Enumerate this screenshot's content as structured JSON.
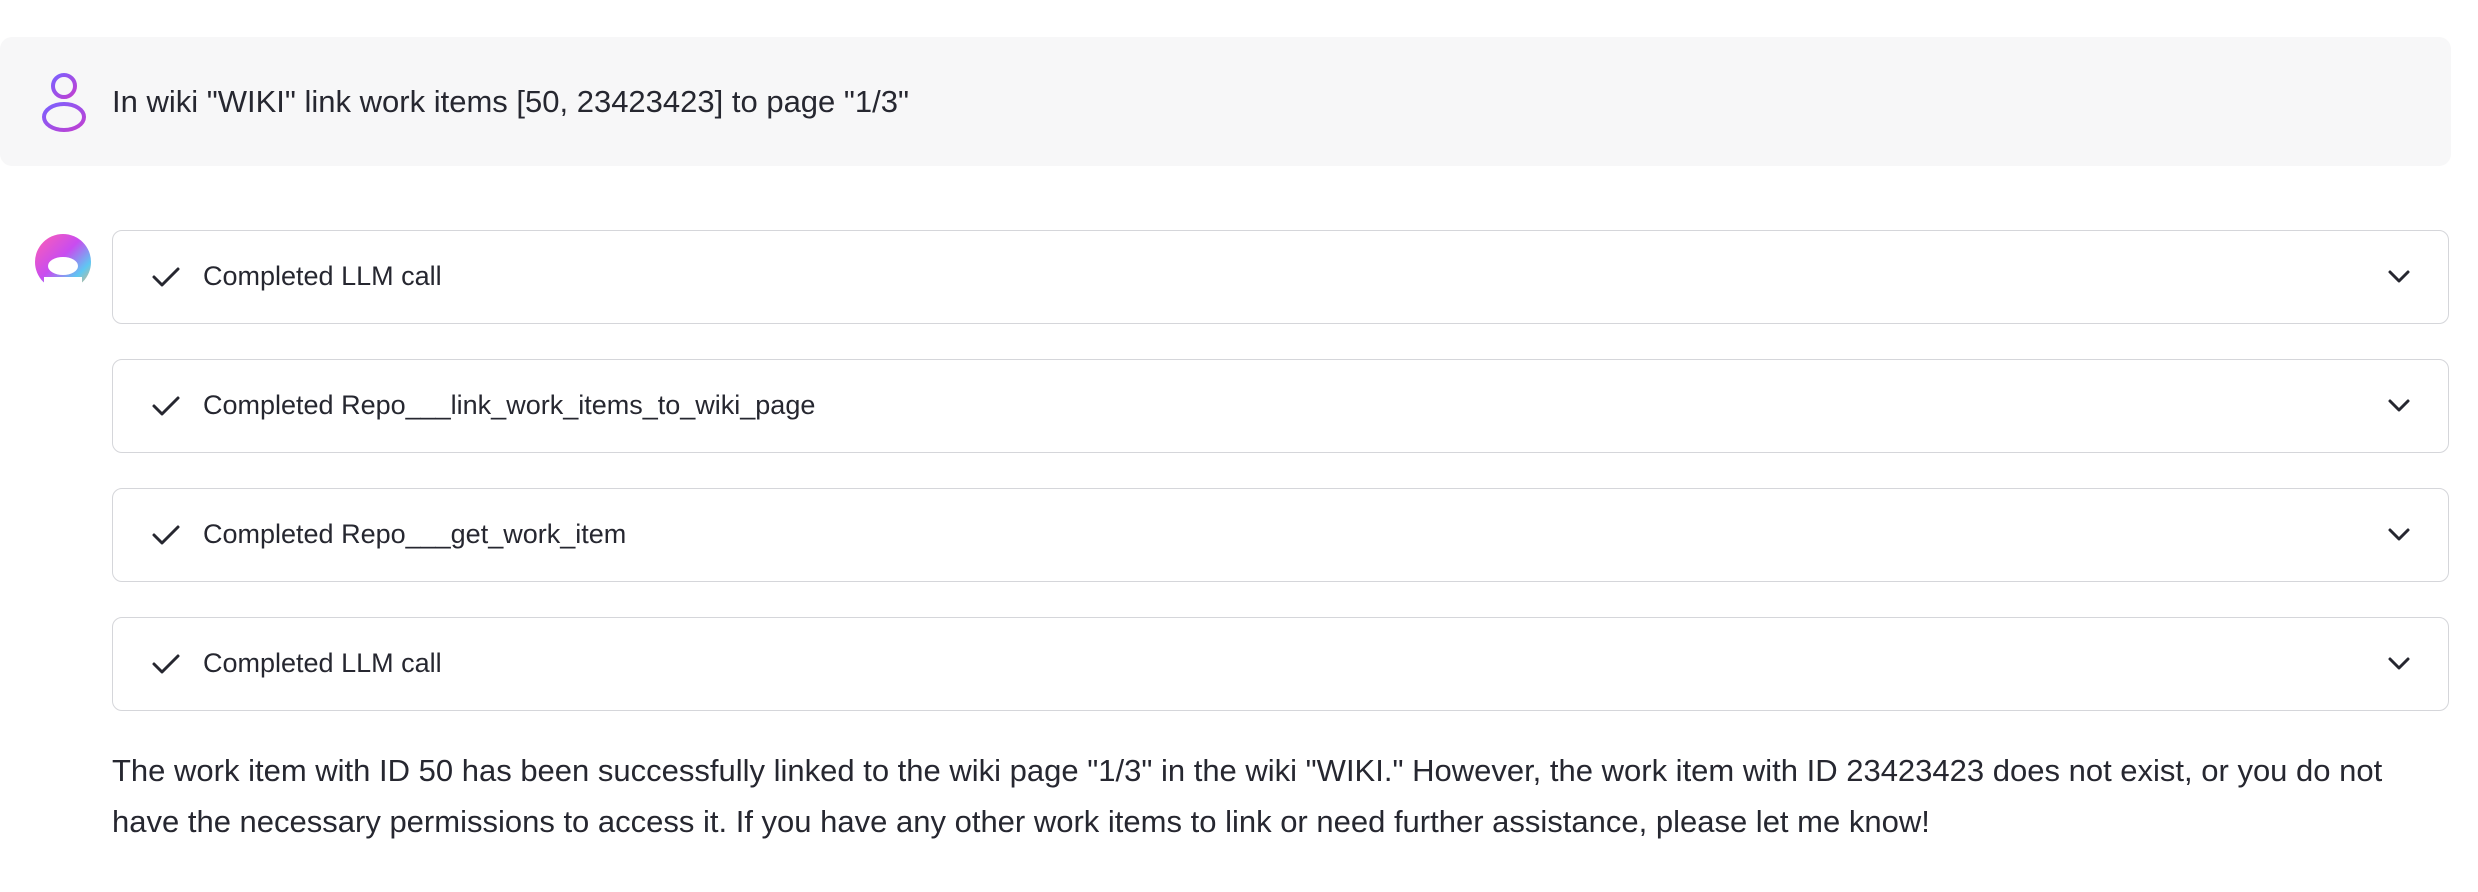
{
  "user_message": {
    "text": "In wiki \"WIKI\" link work items [50, 23423423] to page \"1/3\"",
    "avatar_icon": "user-icon"
  },
  "assistant": {
    "avatar_icon": "assistant-logo-icon",
    "steps": [
      {
        "label": "Completed LLM call",
        "status_icon": "check-icon",
        "toggle_icon": "chevron-down-icon"
      },
      {
        "label": "Completed Repo___link_work_items_to_wiki_page",
        "status_icon": "check-icon",
        "toggle_icon": "chevron-down-icon"
      },
      {
        "label": "Completed Repo___get_work_item",
        "status_icon": "check-icon",
        "toggle_icon": "chevron-down-icon"
      },
      {
        "label": "Completed LLM call",
        "status_icon": "check-icon",
        "toggle_icon": "chevron-down-icon"
      }
    ],
    "response": "The work item with ID 50 has been successfully linked to the wiki page \"1/3\" in the wiki \"WIKI.\" However, the work item with ID 23423423 does not exist, or you do not have the necessary permissions to access it. If you have any other work items to link or need further assistance, please let me know!"
  },
  "colors": {
    "user_bubble_bg": "#f7f7f8",
    "step_border": "#d5d6da",
    "text": "#262730"
  }
}
